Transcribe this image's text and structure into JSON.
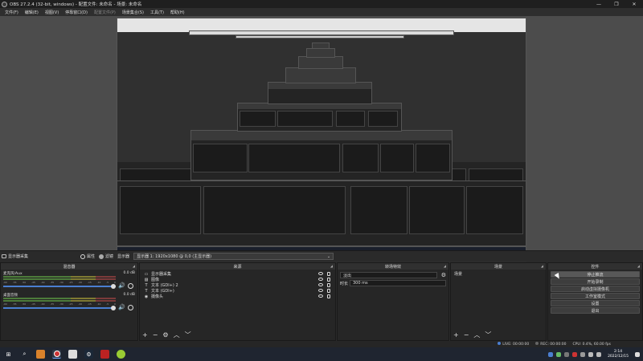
{
  "window": {
    "title": "OBS 27.2.4 (32-bit, windows) - 配置文件: 未命名 - 场景: 未命名",
    "minimize": "—",
    "maximize": "❐",
    "close": "✕"
  },
  "menu": [
    "文件(F)",
    "编辑(E)",
    "视图(V)",
    "停靠窗口(D)",
    "配置文件(P)",
    "场景集合(S)",
    "工具(T)",
    "帮助(H)"
  ],
  "toolbar": {
    "source_name": "显示器采集",
    "properties": "属性",
    "filters": "滤镜",
    "display_label": "显示器",
    "display_value": "显示器 1: 1920x1080 @ 0,0 (主显示器)"
  },
  "mixer": {
    "title": "混音器",
    "tracks": [
      {
        "name": "麦克风/Aux",
        "db": "0.0 dB"
      },
      {
        "name": "桌面音频",
        "db": "0.0 dB"
      }
    ],
    "scale": [
      "-60",
      "-55",
      "-50",
      "-45",
      "-40",
      "-35",
      "-30",
      "-25",
      "-20",
      "-15",
      "-10",
      "-5",
      "0"
    ]
  },
  "sources": {
    "title": "来源",
    "items": [
      {
        "icon": "monitor-icon",
        "glyph": "▭",
        "label": "显示器采集"
      },
      {
        "icon": "image-icon",
        "glyph": "▨",
        "label": "图像"
      },
      {
        "icon": "text-icon",
        "glyph": "T",
        "label": "文本 (GDI+) 2"
      },
      {
        "icon": "text-icon",
        "glyph": "T",
        "label": "文本 (GDI+)"
      },
      {
        "icon": "camera-icon",
        "glyph": "◉",
        "label": "摄像头"
      }
    ]
  },
  "transitions": {
    "title": "转场特效",
    "type_value": "淡出",
    "duration_label": "时长",
    "duration_value": "300 ms"
  },
  "scenes": {
    "title": "场景",
    "items": [
      "场景"
    ]
  },
  "controls": {
    "title": "控件",
    "buttons": [
      "停止推流",
      "开始录制",
      "启动虚拟摄像机",
      "工作室模式",
      "设置",
      "退出"
    ]
  },
  "status": {
    "live": "LIVE: 00:00:00",
    "rec": "REC: 00:00:00",
    "cpu": "CPU: 0.4%, 60.00 fps"
  },
  "taskbar": {
    "time": "2:14",
    "date": "2022/12/15"
  },
  "colors": {
    "accent": "#4b7fd1",
    "panel_bg": "#262626",
    "preview_bg": "#4c4c4c"
  }
}
